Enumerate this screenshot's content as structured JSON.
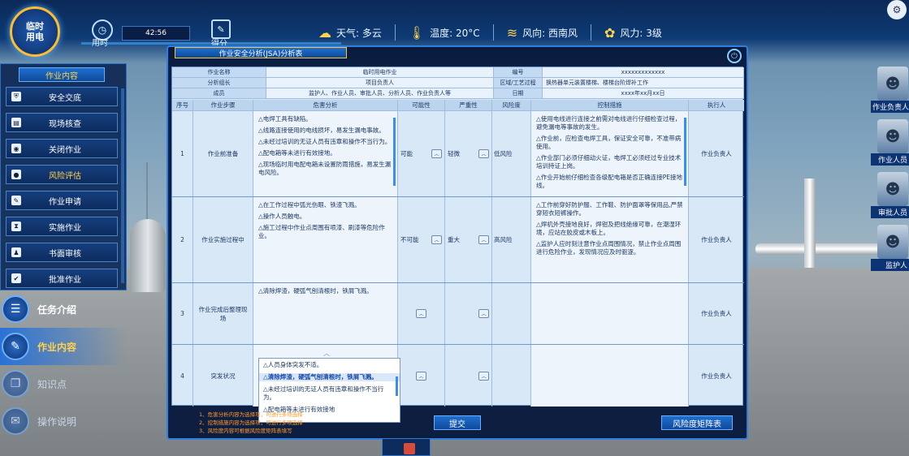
{
  "header": {
    "badge": "临时\n用电",
    "time_label": "用时",
    "time_value": "42:56",
    "score_label": "得分",
    "weather": "天气: 多云",
    "temperature": "温度: 20°C",
    "wind_dir": "风向: 西南风",
    "wind_force": "风力: 3级"
  },
  "sidebar": {
    "title": "作业内容",
    "items": [
      {
        "label": "安全交底"
      },
      {
        "label": "现场核查"
      },
      {
        "label": "关闭作业"
      },
      {
        "label": "风险评估"
      },
      {
        "label": "作业申请"
      },
      {
        "label": "实施作业"
      },
      {
        "label": "书面审核"
      },
      {
        "label": "批准作业"
      }
    ]
  },
  "mainmenu": [
    {
      "label": "任务介绍"
    },
    {
      "label": "作业内容"
    },
    {
      "label": "知识点"
    },
    {
      "label": "操作说明"
    }
  ],
  "roles": [
    {
      "label": "作业负责人"
    },
    {
      "label": "作业人员"
    },
    {
      "label": "审批人员"
    },
    {
      "label": "监护人"
    }
  ],
  "dialog": {
    "title": "作业安全分析(JSA)分析表",
    "info": {
      "job_name_label": "作业名称",
      "job_name": "临时用电作业",
      "number_label": "编号",
      "number": "xxxxxxxxxxxxx",
      "leader_label": "分析组长",
      "leader": "项目负责人",
      "area_label": "区域/工艺过程",
      "area": "换热器单元装置楼梯、楼梯台阶焊补工作",
      "members_label": "成员",
      "members": "监护人、作业人员、审批人员、分析人员、作业负责人等",
      "date_label": "日期",
      "date": "xxxx年xx月xx日"
    },
    "columns": [
      "序号",
      "作业步骤",
      "危害分析",
      "可能性",
      "严重性",
      "风险度",
      "控制措施",
      "执行人"
    ],
    "rows": [
      {
        "no": "1",
        "step": "作业前准备",
        "hazards": [
          "△电焊工具有缺陷。",
          "△线路连接使用的电线损坏，易发生漏电事故。",
          "△未经过培训的无证人员有违章和操作不当行为。",
          "△配电箱等未进行有效接地。",
          "△现场临时用电配电箱未设置防雨措施，易发生漏电风险。"
        ],
        "likelihood": "可能",
        "severity": "轻微",
        "risk": "低风险",
        "controls": [
          "△使用电线进行连接之前需对电线进行仔细检查过程，避免漏电等事故的发生。",
          "△作业前，应检查电焊工具，保证安全可靠，不准带病使用。",
          "△作业部门必须仔细动火证，电焊工必须经过专业技术培训持证上岗。",
          "△作业开始前仔细检查各级配电箱是否正确连接PE接地线。"
        ],
        "executor": "作业负责人"
      },
      {
        "no": "2",
        "step": "作业实施过程中",
        "hazards": [
          "△在工作过程中弧光伤眼、铁渣飞溅。",
          "△操作人员触电。",
          "△施工过程中作业点周围有喷漆、刷漆等危险作业。"
        ],
        "likelihood": "不可能",
        "severity": "重大",
        "risk": "高风险",
        "controls": [
          "△工作前穿好防护服、工作鞋、防护面罩等保用品,严禁穿短衣短裤操作。",
          "△焊机外壳接地良好，焊钳及把线绝缘可靠，在潮湿环境，应站在胶皮或木板上。",
          "△监护人应时刻注意作业点周围情况，禁止作业点周围进行危险作业，发现情况应及时驱逐。"
        ],
        "executor": "作业负责人"
      },
      {
        "no": "3",
        "step": "作业完成后整理现场",
        "hazards": [
          "△清除焊渣，硬弧气刨清根时，铁屑飞溅。"
        ],
        "likelihood": "",
        "severity": "",
        "risk": "",
        "controls": [],
        "executor": "作业负责人"
      },
      {
        "no": "4",
        "step": "突发状况",
        "hazards": [],
        "likelihood": "",
        "severity": "",
        "risk": "",
        "controls": [],
        "executor": "作业负责人"
      }
    ],
    "popup_options": [
      "△人员身体突发不适。",
      "△清除焊渣，硬弧气刨清根时，铁屑飞溅。",
      "△未经过培训的无证人员有违章和操作不当行为。",
      "△配电箱等未进行有效接地"
    ],
    "notes": [
      "1、危害分析内容为选择项，可进行多项选择",
      "2、控制措施内容为选择项，可进行多项选择",
      "3、风险度内容可根据风险度矩阵表填写"
    ],
    "submit": "提交",
    "matrix": "风险度矩阵表"
  }
}
